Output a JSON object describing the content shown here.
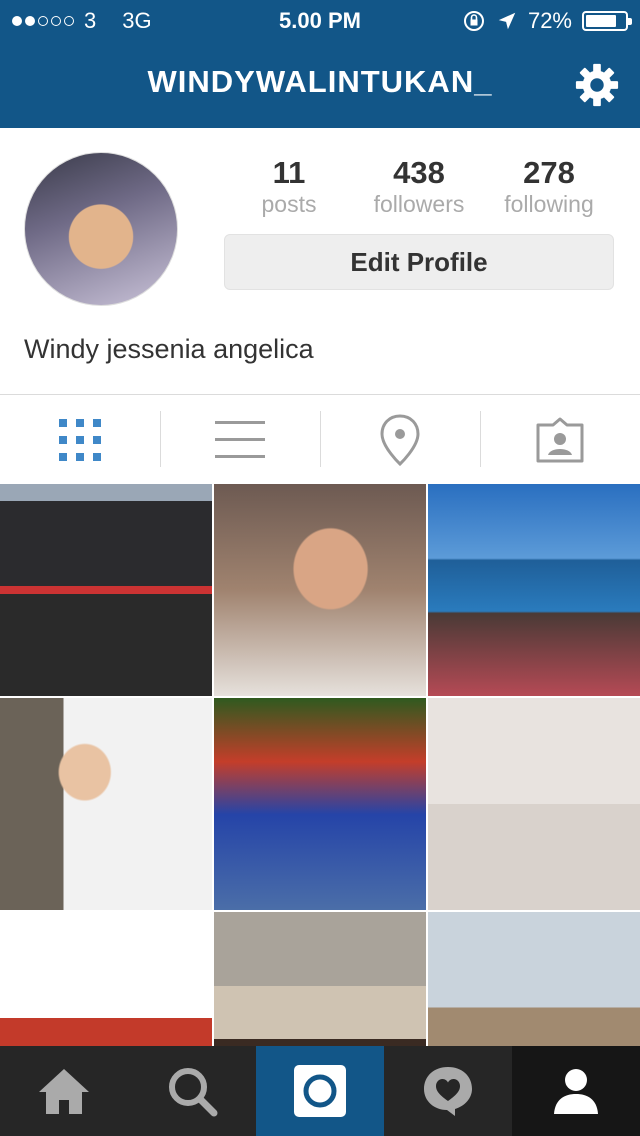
{
  "status_bar": {
    "carrier": "3",
    "network": "3G",
    "time": "5.00 PM",
    "battery": "72%"
  },
  "nav": {
    "title": "WINDYWALINTUKAN_",
    "settings_icon": "gear-icon"
  },
  "profile": {
    "stats": [
      {
        "value": "11",
        "label": "posts"
      },
      {
        "value": "438",
        "label": "followers"
      },
      {
        "value": "278",
        "label": "following"
      }
    ],
    "edit_button": "Edit Profile",
    "full_name": "Windy jessenia angelica"
  },
  "tabs": [
    "grid-icon",
    "list-icon",
    "location-pin-icon",
    "tagged-photos-icon"
  ],
  "bottom_nav": [
    "home-icon",
    "search-icon",
    "camera-icon",
    "activity-heart-icon",
    "profile-icon"
  ],
  "colors": {
    "brand": "#125688",
    "bottom_bar": "#262626",
    "active_tab": "#3f729b"
  }
}
